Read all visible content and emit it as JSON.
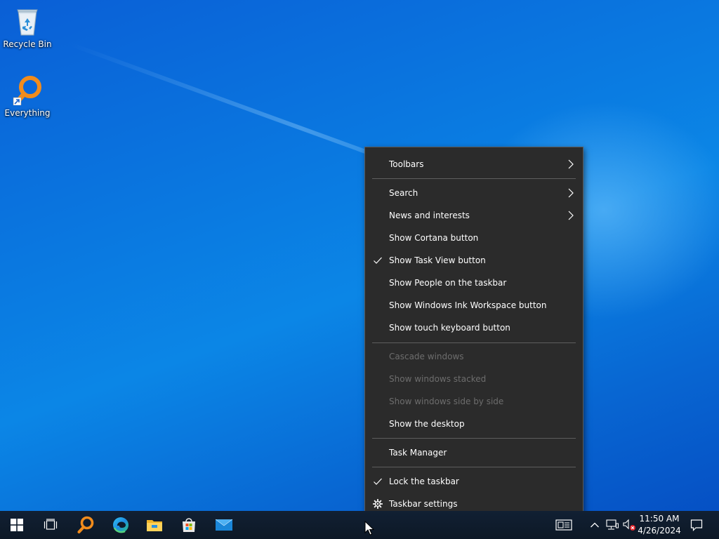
{
  "desktop": {
    "icons": [
      {
        "label": "Recycle Bin",
        "icon": "recycle-bin-icon"
      },
      {
        "label": "Everything",
        "icon": "everything-search-icon"
      }
    ]
  },
  "context_menu": {
    "items": [
      {
        "label": "Toolbars",
        "submenu": true
      },
      {
        "label": "Search",
        "submenu": true
      },
      {
        "label": "News and interests",
        "submenu": true
      },
      {
        "label": "Show Cortana button"
      },
      {
        "label": "Show Task View button",
        "checked": true
      },
      {
        "label": "Show People on the taskbar"
      },
      {
        "label": "Show Windows Ink Workspace button"
      },
      {
        "label": "Show touch keyboard button"
      },
      {
        "label": "Cascade windows",
        "disabled": true
      },
      {
        "label": "Show windows stacked",
        "disabled": true
      },
      {
        "label": "Show windows side by side",
        "disabled": true
      },
      {
        "label": "Show the desktop"
      },
      {
        "label": "Task Manager"
      },
      {
        "label": "Lock the taskbar",
        "checked": true
      },
      {
        "label": "Taskbar settings",
        "icon": "gear-icon"
      }
    ]
  },
  "taskbar": {
    "pinned": [
      "start-windows-icon",
      "task-view-icon",
      "everything-search-icon",
      "edge-browser-icon",
      "file-explorer-icon",
      "microsoft-store-icon",
      "mail-icon"
    ],
    "tray": {
      "icons": [
        "news-widget-icon",
        "show-hidden-icons-chevron-icon",
        "network-icon",
        "volume-muted-icon",
        "notification-center-icon"
      ],
      "time": "11:50 AM",
      "date": "4/26/2024"
    }
  },
  "colors": {
    "menu_bg": "#2b2b2b",
    "menu_text": "#ffffff",
    "menu_disabled_text": "#6d6d6d",
    "taskbar_bg": "#0f1b2a",
    "desktop_blue": "#0a78e0"
  }
}
